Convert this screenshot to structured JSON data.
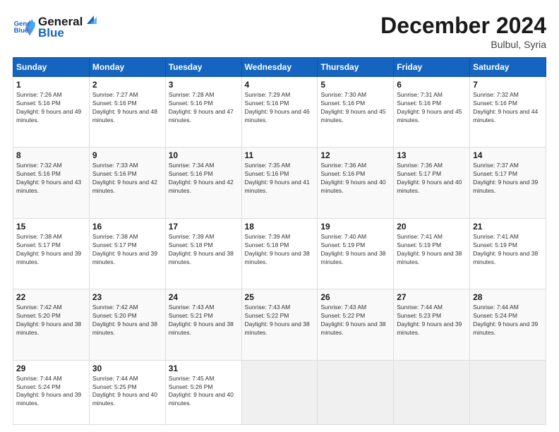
{
  "header": {
    "logo_line1": "General",
    "logo_line2": "Blue",
    "month_year": "December 2024",
    "location": "Bulbul, Syria"
  },
  "weekdays": [
    "Sunday",
    "Monday",
    "Tuesday",
    "Wednesday",
    "Thursday",
    "Friday",
    "Saturday"
  ],
  "weeks": [
    [
      {
        "day": "1",
        "sunrise": "7:26 AM",
        "sunset": "5:16 PM",
        "daylight": "9 hours and 49 minutes."
      },
      {
        "day": "2",
        "sunrise": "7:27 AM",
        "sunset": "5:16 PM",
        "daylight": "9 hours and 48 minutes."
      },
      {
        "day": "3",
        "sunrise": "7:28 AM",
        "sunset": "5:16 PM",
        "daylight": "9 hours and 47 minutes."
      },
      {
        "day": "4",
        "sunrise": "7:29 AM",
        "sunset": "5:16 PM",
        "daylight": "9 hours and 46 minutes."
      },
      {
        "day": "5",
        "sunrise": "7:30 AM",
        "sunset": "5:16 PM",
        "daylight": "9 hours and 45 minutes."
      },
      {
        "day": "6",
        "sunrise": "7:31 AM",
        "sunset": "5:16 PM",
        "daylight": "9 hours and 45 minutes."
      },
      {
        "day": "7",
        "sunrise": "7:32 AM",
        "sunset": "5:16 PM",
        "daylight": "9 hours and 44 minutes."
      }
    ],
    [
      {
        "day": "8",
        "sunrise": "7:32 AM",
        "sunset": "5:16 PM",
        "daylight": "9 hours and 43 minutes."
      },
      {
        "day": "9",
        "sunrise": "7:33 AM",
        "sunset": "5:16 PM",
        "daylight": "9 hours and 42 minutes."
      },
      {
        "day": "10",
        "sunrise": "7:34 AM",
        "sunset": "5:16 PM",
        "daylight": "9 hours and 42 minutes."
      },
      {
        "day": "11",
        "sunrise": "7:35 AM",
        "sunset": "5:16 PM",
        "daylight": "9 hours and 41 minutes."
      },
      {
        "day": "12",
        "sunrise": "7:36 AM",
        "sunset": "5:16 PM",
        "daylight": "9 hours and 40 minutes."
      },
      {
        "day": "13",
        "sunrise": "7:36 AM",
        "sunset": "5:17 PM",
        "daylight": "9 hours and 40 minutes."
      },
      {
        "day": "14",
        "sunrise": "7:37 AM",
        "sunset": "5:17 PM",
        "daylight": "9 hours and 39 minutes."
      }
    ],
    [
      {
        "day": "15",
        "sunrise": "7:38 AM",
        "sunset": "5:17 PM",
        "daylight": "9 hours and 39 minutes."
      },
      {
        "day": "16",
        "sunrise": "7:38 AM",
        "sunset": "5:17 PM",
        "daylight": "9 hours and 39 minutes."
      },
      {
        "day": "17",
        "sunrise": "7:39 AM",
        "sunset": "5:18 PM",
        "daylight": "9 hours and 38 minutes."
      },
      {
        "day": "18",
        "sunrise": "7:39 AM",
        "sunset": "5:18 PM",
        "daylight": "9 hours and 38 minutes."
      },
      {
        "day": "19",
        "sunrise": "7:40 AM",
        "sunset": "5:19 PM",
        "daylight": "9 hours and 38 minutes."
      },
      {
        "day": "20",
        "sunrise": "7:41 AM",
        "sunset": "5:19 PM",
        "daylight": "9 hours and 38 minutes."
      },
      {
        "day": "21",
        "sunrise": "7:41 AM",
        "sunset": "5:19 PM",
        "daylight": "9 hours and 38 minutes."
      }
    ],
    [
      {
        "day": "22",
        "sunrise": "7:42 AM",
        "sunset": "5:20 PM",
        "daylight": "9 hours and 38 minutes."
      },
      {
        "day": "23",
        "sunrise": "7:42 AM",
        "sunset": "5:20 PM",
        "daylight": "9 hours and 38 minutes."
      },
      {
        "day": "24",
        "sunrise": "7:43 AM",
        "sunset": "5:21 PM",
        "daylight": "9 hours and 38 minutes."
      },
      {
        "day": "25",
        "sunrise": "7:43 AM",
        "sunset": "5:22 PM",
        "daylight": "9 hours and 38 minutes."
      },
      {
        "day": "26",
        "sunrise": "7:43 AM",
        "sunset": "5:22 PM",
        "daylight": "9 hours and 38 minutes."
      },
      {
        "day": "27",
        "sunrise": "7:44 AM",
        "sunset": "5:23 PM",
        "daylight": "9 hours and 39 minutes."
      },
      {
        "day": "28",
        "sunrise": "7:44 AM",
        "sunset": "5:24 PM",
        "daylight": "9 hours and 39 minutes."
      }
    ],
    [
      {
        "day": "29",
        "sunrise": "7:44 AM",
        "sunset": "5:24 PM",
        "daylight": "9 hours and 39 minutes."
      },
      {
        "day": "30",
        "sunrise": "7:44 AM",
        "sunset": "5:25 PM",
        "daylight": "9 hours and 40 minutes."
      },
      {
        "day": "31",
        "sunrise": "7:45 AM",
        "sunset": "5:26 PM",
        "daylight": "9 hours and 40 minutes."
      },
      null,
      null,
      null,
      null
    ]
  ]
}
